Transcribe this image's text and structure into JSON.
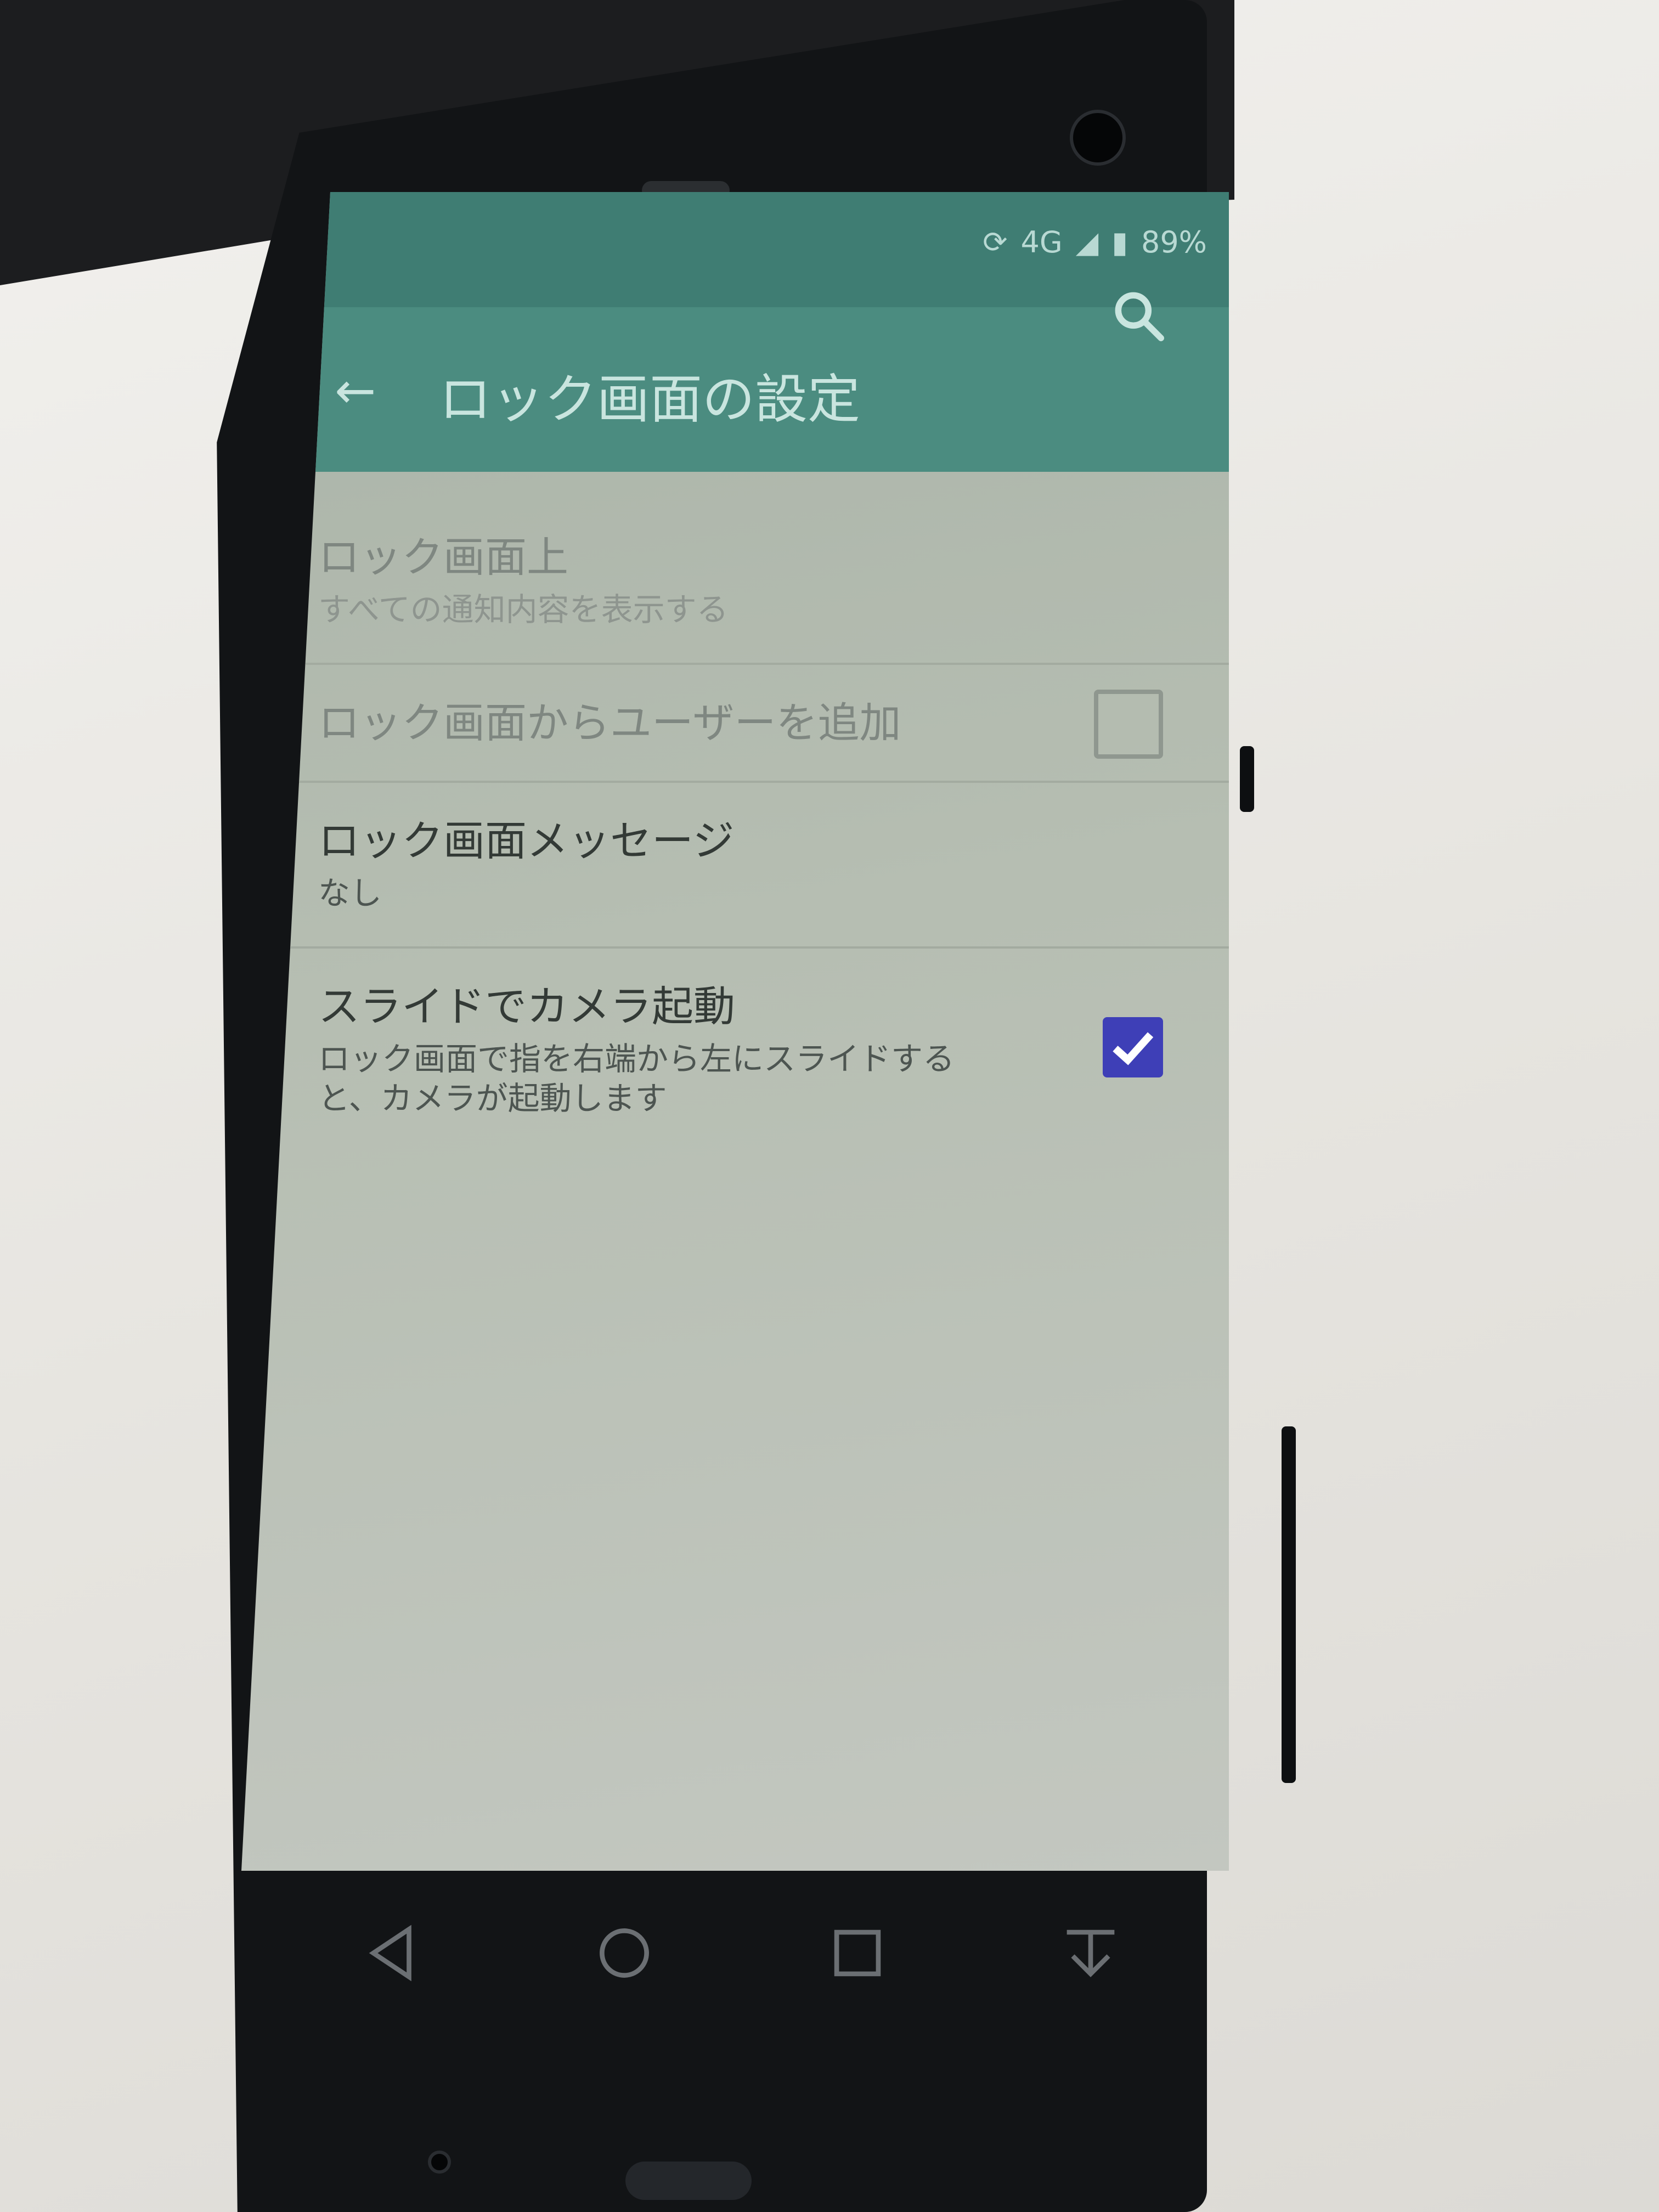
{
  "status_bar": {
    "network": "4G",
    "battery": "89%"
  },
  "app_bar": {
    "title": "ロック画面の設定"
  },
  "preferences": [
    {
      "title": "ロック画面上",
      "summary": "すべての通知内容を表示する",
      "enabled": false
    },
    {
      "title": "ロック画面からユーザーを追加",
      "summary": "",
      "enabled": false,
      "checked": false
    },
    {
      "title": "ロック画面メッセージ",
      "summary": "なし",
      "enabled": true
    },
    {
      "title": "スライドでカメラ起動",
      "summary": "ロック画面で指を右端から左にスライドすると、カメラが起動します",
      "enabled": true,
      "checked": true
    }
  ],
  "colors": {
    "accent": "#3e3fb7",
    "app_bar": "#4b8c80",
    "status_bar": "#3f7d73"
  },
  "icons": [
    "back-arrow-icon",
    "search-icon",
    "nav-back-icon",
    "nav-home-icon",
    "nav-recents-icon",
    "nav-hide-icon"
  ]
}
